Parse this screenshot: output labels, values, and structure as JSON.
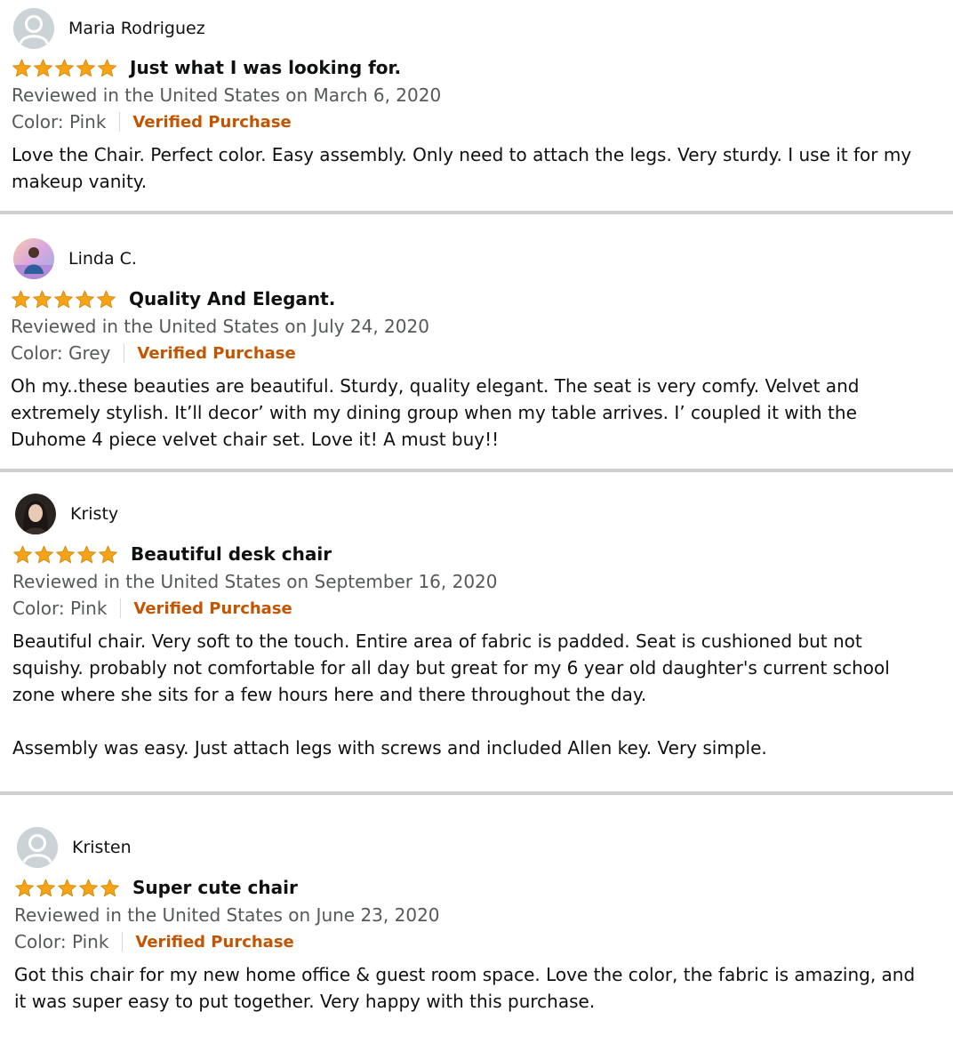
{
  "colors": {
    "star": "#f6a416",
    "star_outline": "#d28a0d",
    "verified": "#c45500",
    "meta": "#565959",
    "text": "#0f1111",
    "divider": "#cfcfcf"
  },
  "reviews": [
    {
      "reviewer": "Maria Rodriguez",
      "avatar": "default-avatar-icon",
      "rating": 5,
      "max_rating": 5,
      "title": "Just what I was looking for.",
      "meta": "Reviewed in the United States on March 6, 2020",
      "color": "Color: Pink",
      "verified": "Verified Purchase",
      "body": [
        "Love the Chair. Perfect color. Easy assembly. Only need to attach the legs. Very sturdy. I use it for my makeup vanity."
      ]
    },
    {
      "reviewer": "Linda C.",
      "avatar": "user-photo-avatar",
      "rating": 5,
      "max_rating": 5,
      "title": "Quality And Elegant.",
      "meta": "Reviewed in the United States on July 24, 2020",
      "color": "Color: Grey",
      "verified": "Verified Purchase",
      "body": [
        "Oh my..these beauties are beautiful. Sturdy, quality elegant. The seat is very comfy. Velvet and extremely stylish. It’ll decor’ with my dining group when my table arrives. I’ coupled it with the Duhome 4 piece velvet chair set. Love it! A must buy!!"
      ]
    },
    {
      "reviewer": "Kristy",
      "avatar": "user-photo-avatar",
      "rating": 5,
      "max_rating": 5,
      "title": "Beautiful desk chair",
      "meta": "Reviewed in the United States on September 16, 2020",
      "color": "Color: Pink",
      "verified": "Verified Purchase",
      "body": [
        "Beautiful chair. Very soft to the touch. Entire area of fabric is padded. Seat is cushioned but not squishy. probably not comfortable for all day but great for my 6 year old daughter's current school zone where she sits for a few hours here and there throughout the day.",
        "Assembly was easy. Just attach legs with screws and included Allen key. Very simple."
      ]
    },
    {
      "reviewer": "Kristen",
      "avatar": "default-avatar-icon",
      "rating": 5,
      "max_rating": 5,
      "title": "Super cute chair",
      "meta": "Reviewed in the United States on June 23, 2020",
      "color": "Color: Pink",
      "verified": "Verified Purchase",
      "body": [
        "Got this chair for my new home office & guest room space. Love the color, the fabric is amazing, and it was super easy to put together. Very happy with this purchase."
      ]
    }
  ]
}
